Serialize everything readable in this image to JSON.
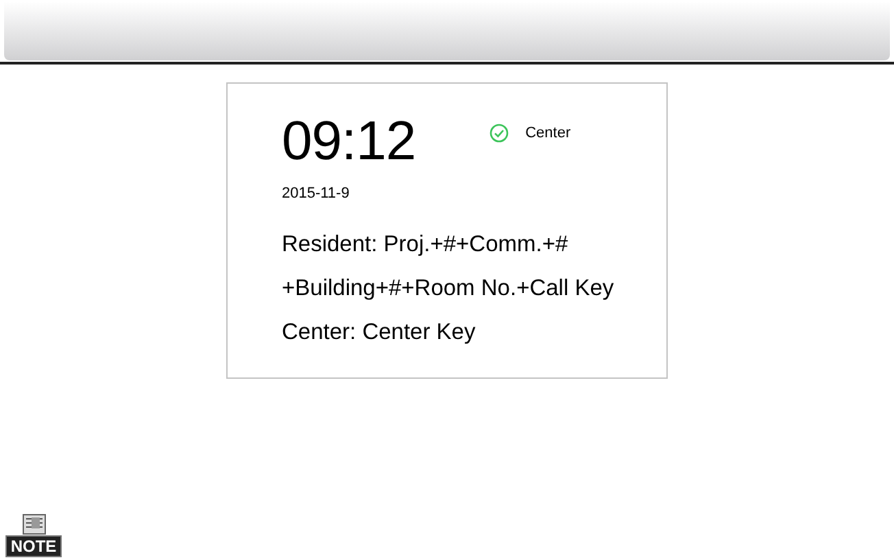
{
  "screen": {
    "time": "09:12",
    "status": {
      "label": "Center",
      "connected": true
    },
    "date": "2015-11-9",
    "lines": [
      "Resident: Proj.+#+Comm.+#",
      "+Building+#+Room No.+Call Key",
      "Center: Center Key"
    ]
  },
  "note": {
    "label": "NOTE"
  }
}
